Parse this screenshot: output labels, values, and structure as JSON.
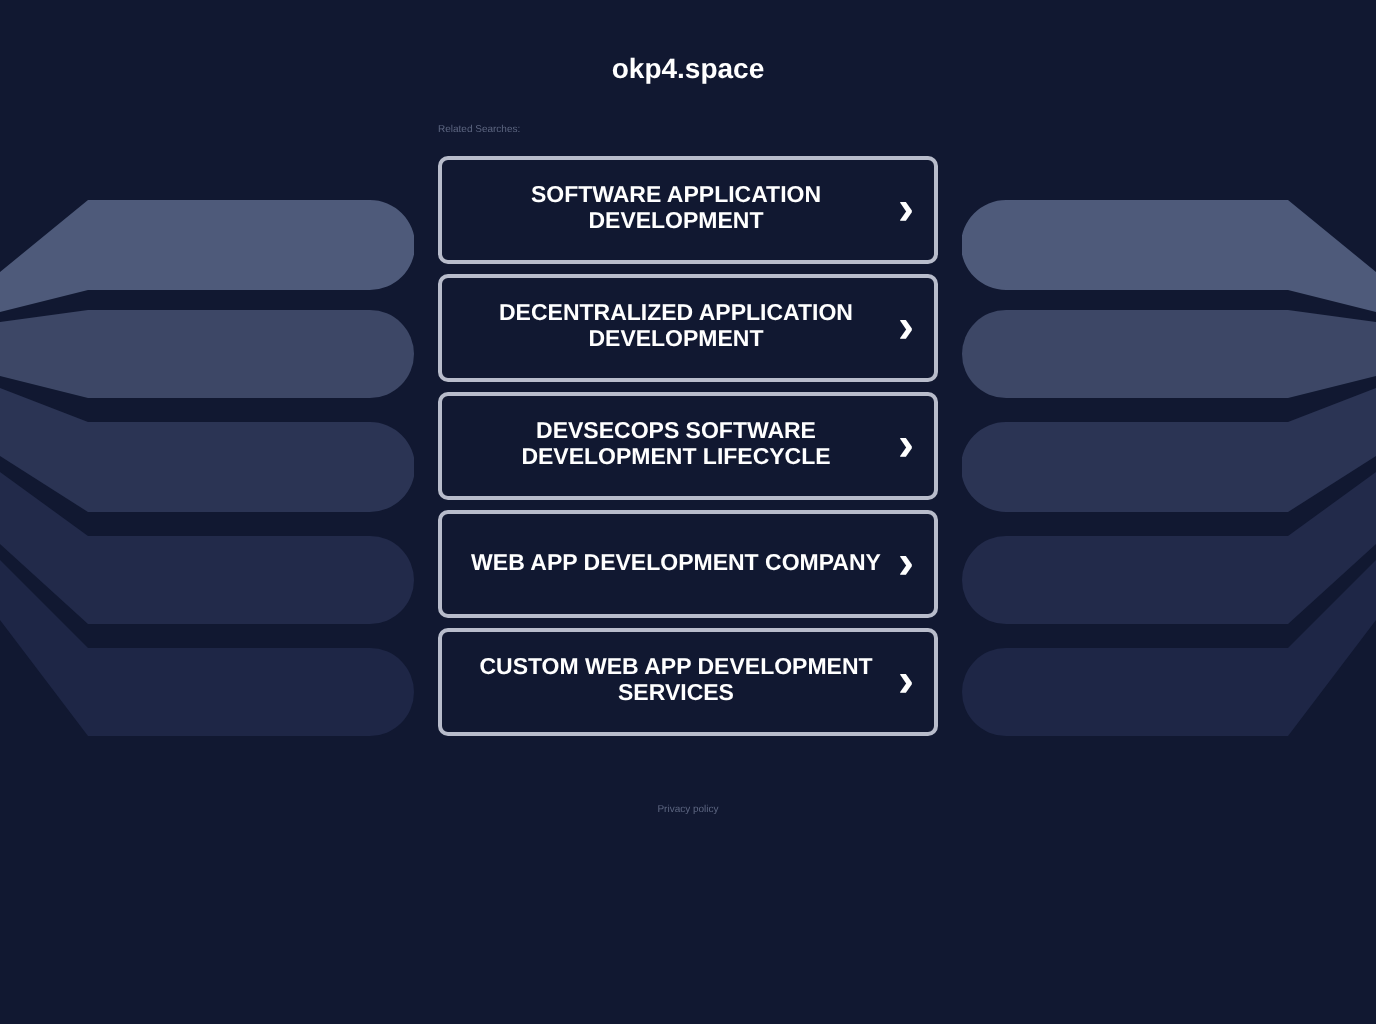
{
  "site_title": "okp4.space",
  "related_label": "Related Searches:",
  "links": [
    {
      "label": "SOFTWARE APPLICATION DEVELOPMENT",
      "arrow": "›"
    },
    {
      "label": "DECENTRALIZED APPLICATION DEVELOPMENT",
      "arrow": "›"
    },
    {
      "label": "DEVSECOPS SOFTWARE DEVELOPMENT LIFECYCLE",
      "arrow": "›"
    },
    {
      "label": "WEB APP DEVELOPMENT COMPANY",
      "arrow": "›"
    },
    {
      "label": "CUSTOM WEB APP DEVELOPMENT SERVICES",
      "arrow": "›"
    }
  ],
  "footer_link": "Privacy policy"
}
